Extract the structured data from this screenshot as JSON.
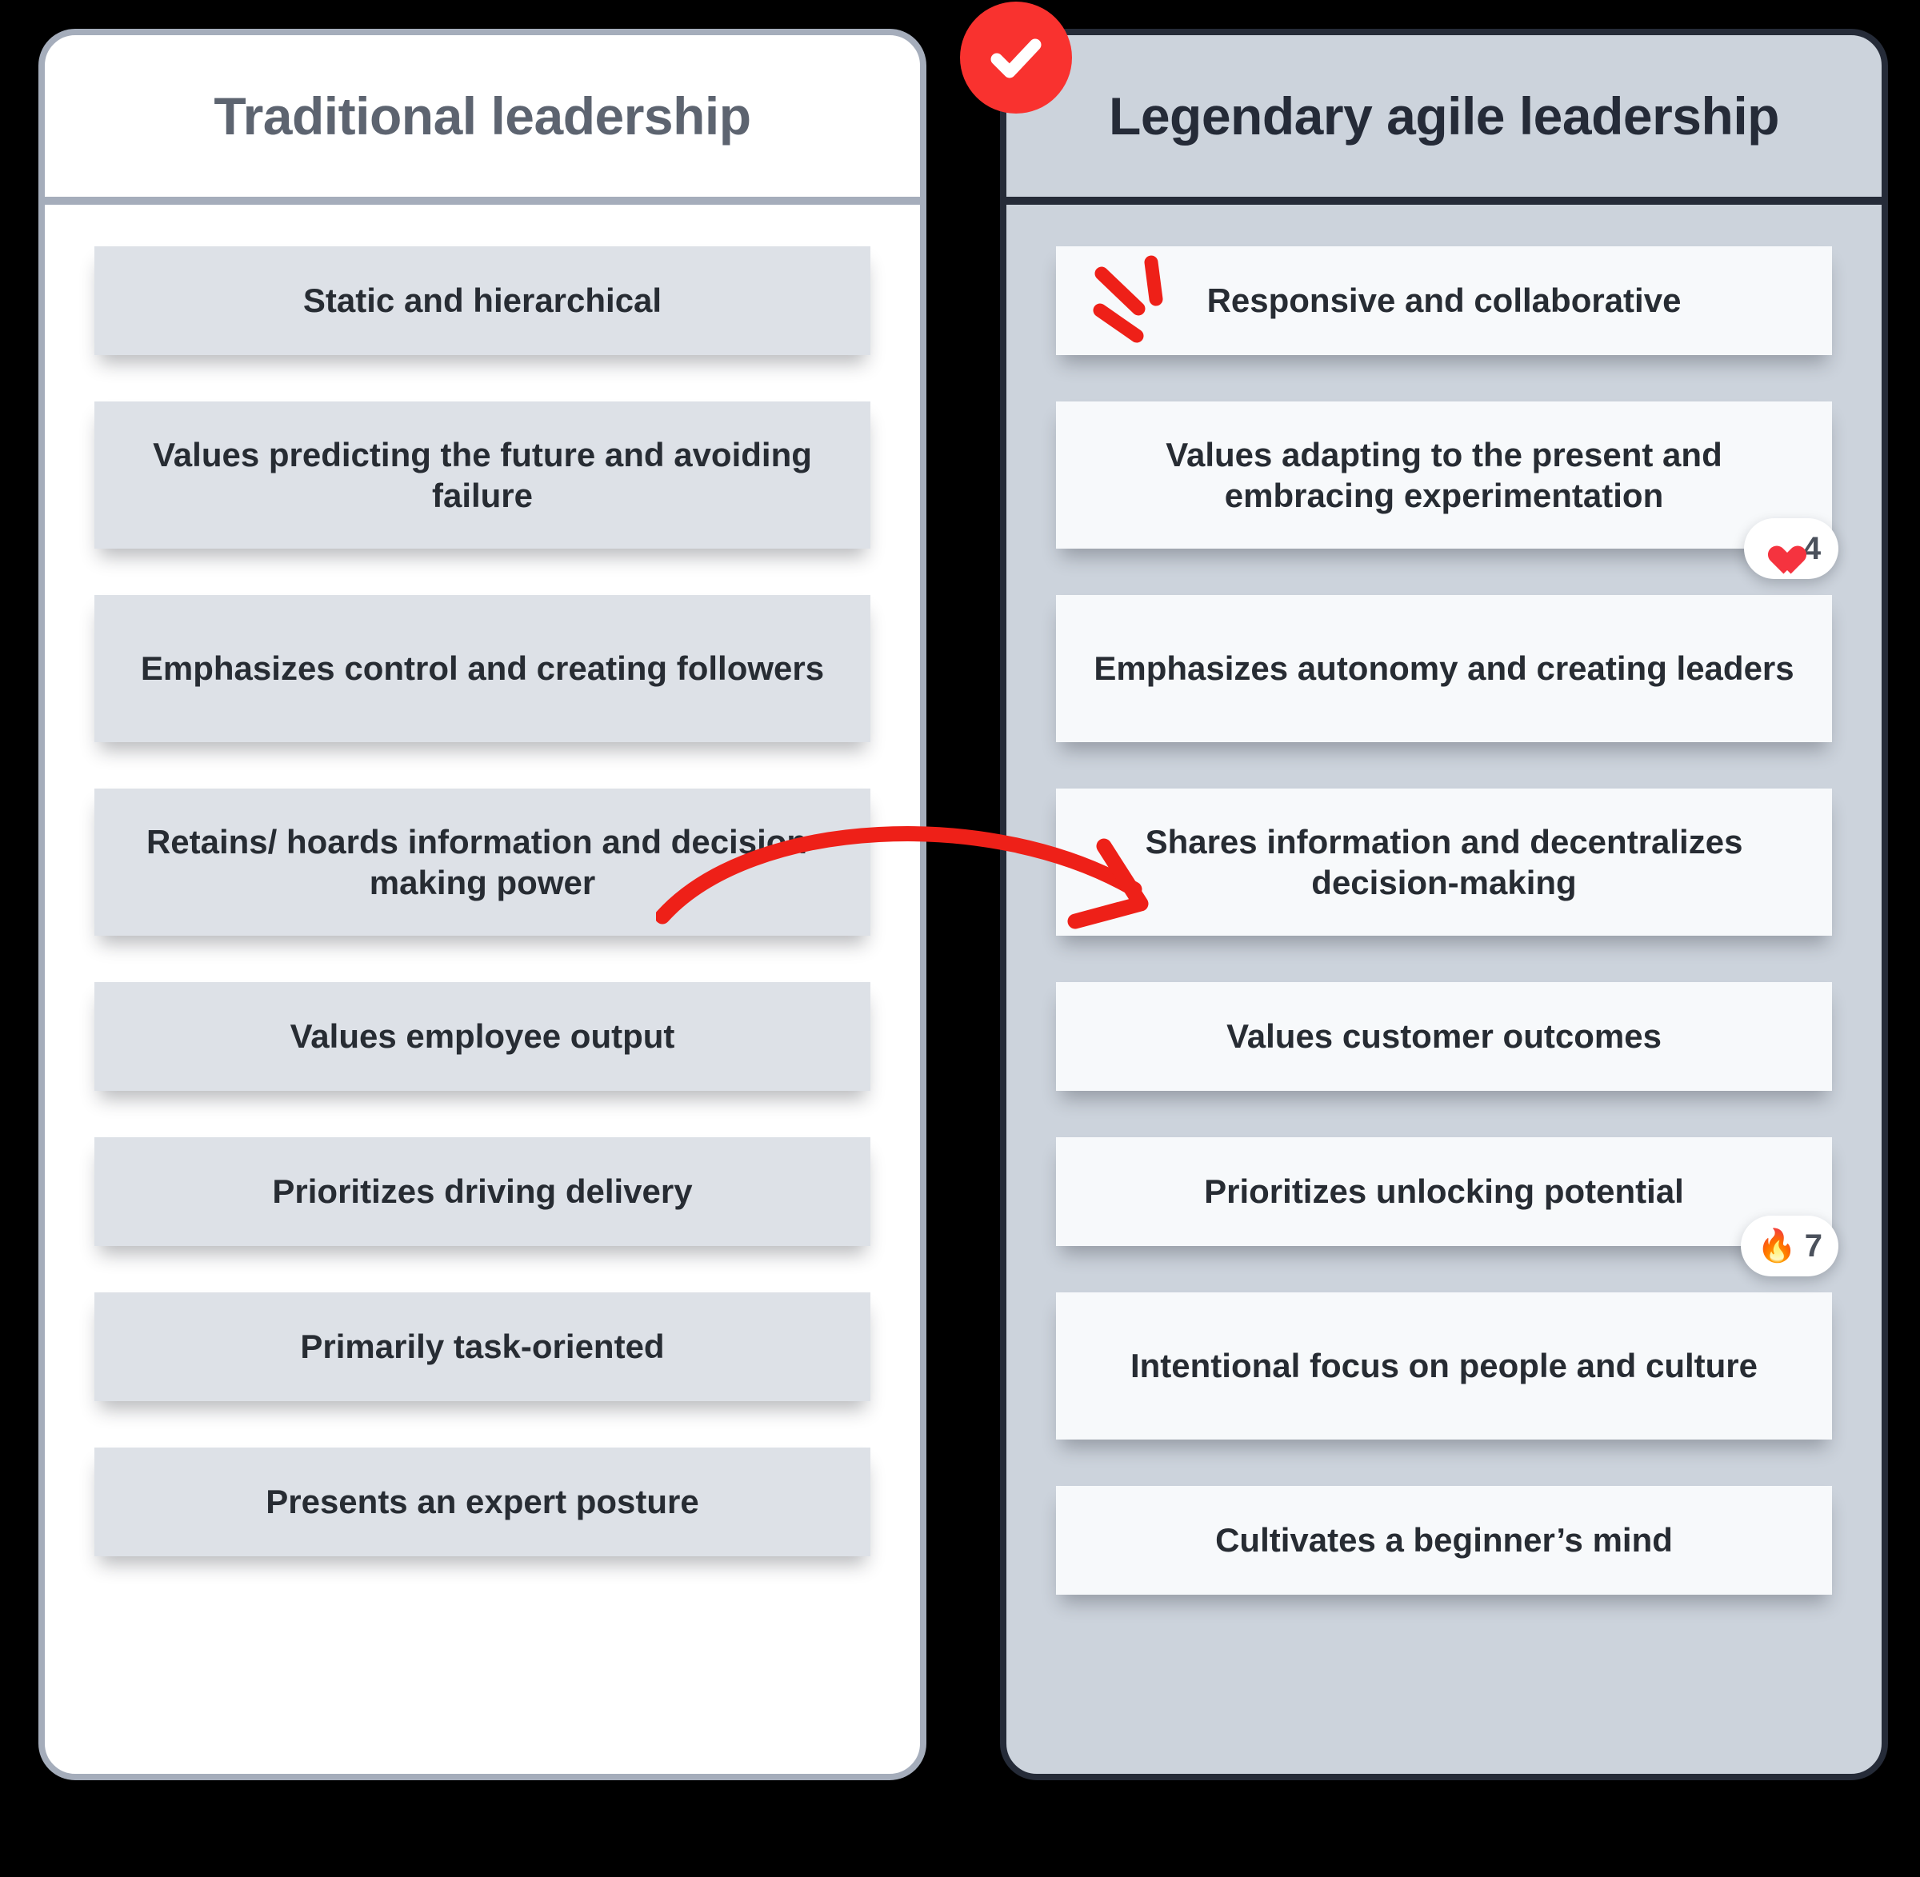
{
  "background_color": "#000000",
  "accent_color": "#f9322f",
  "left_card": {
    "title": "Traditional leadership",
    "background_color": "#ffffff",
    "border_color": "#a5adbb",
    "title_color": "#5d6470",
    "item_background": "#dde1e7",
    "items": [
      {
        "text": "Static and hierarchical",
        "lines": 1
      },
      {
        "text": "Values predicting the future and avoiding failure",
        "lines": 2
      },
      {
        "text": "Emphasizes control and creating followers",
        "lines": 2
      },
      {
        "text": "Retains/ hoards information and decision-making power",
        "lines": 2
      },
      {
        "text": "Values employee output",
        "lines": 1
      },
      {
        "text": "Prioritizes driving delivery",
        "lines": 1
      },
      {
        "text": "Primarily task-oriented",
        "lines": 1
      },
      {
        "text": "Presents an expert posture",
        "lines": 1
      }
    ]
  },
  "right_card": {
    "title": "Legendary agile leadership",
    "background_color": "#ccd3dc",
    "border_color": "#252b38",
    "title_color": "#252b38",
    "item_background": "#f7f9fb",
    "badge": {
      "icon": "check-icon",
      "color": "#f9322f"
    },
    "items": [
      {
        "text": "Responsive and collaborative",
        "lines": 1
      },
      {
        "text": "Values adapting to the present and embracing experimentation",
        "lines": 2
      },
      {
        "text": "Emphasizes autonomy and creating leaders",
        "lines": 2
      },
      {
        "text": "Shares information and decentralizes decision-making",
        "lines": 2
      },
      {
        "text": "Values customer outcomes",
        "lines": 1
      },
      {
        "text": "Prioritizes unlocking potential",
        "lines": 1
      },
      {
        "text": "Intentional focus on people and culture",
        "lines": 2
      },
      {
        "text": "Cultivates a beginner’s mind",
        "lines": 1
      }
    ],
    "reactions": [
      {
        "on_item": 1,
        "emoji": "heart-emoji",
        "count": "4"
      },
      {
        "on_item": 5,
        "emoji": "fire-emoji",
        "count": "7",
        "glyph": "🔥"
      }
    ]
  },
  "annotations": {
    "arrow": {
      "name": "red-curved-arrow",
      "color": "#ee2018",
      "from_item": "Retains/ hoards information and decision-making power",
      "to_item": "Shares information and decentralizes decision-making"
    },
    "sparkles": {
      "name": "red-sparkle-marks",
      "color": "#ee2018",
      "strokes": 3
    }
  }
}
